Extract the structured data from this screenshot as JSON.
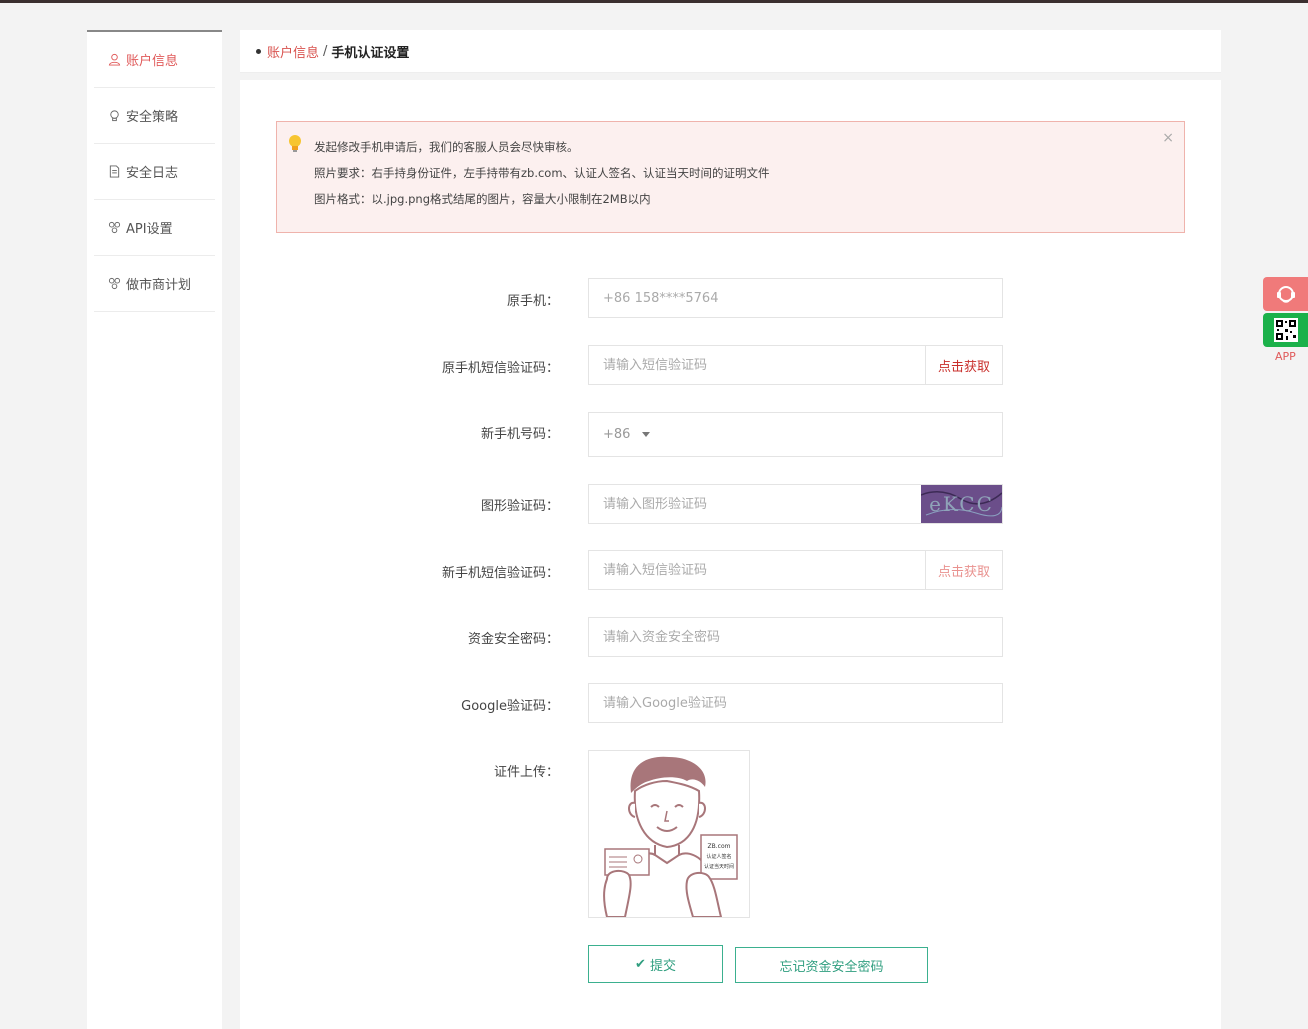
{
  "sidebar": {
    "items": [
      {
        "label": "账户信息",
        "icon": "user-icon",
        "active": true
      },
      {
        "label": "安全策略",
        "icon": "bulb-icon",
        "active": false
      },
      {
        "label": "安全日志",
        "icon": "document-icon",
        "active": false
      },
      {
        "label": "API设置",
        "icon": "api-icon",
        "active": false
      },
      {
        "label": "做市商计划",
        "icon": "api-icon",
        "active": false
      }
    ]
  },
  "breadcrumb": {
    "parent": "账户信息",
    "separator": "/",
    "current": "手机认证设置"
  },
  "alert": {
    "line1": "发起修改手机申请后，我们的客服人员会尽快审核。",
    "line2": "照片要求：右手持身份证件，左手持带有zb.com、认证人签名、认证当天时间的证明文件",
    "line3": "图片格式：以.jpg.png格式结尾的图片，容量大小限制在2MB以内",
    "close": "×"
  },
  "form": {
    "old_phone_label": "原手机：",
    "old_phone_value": "+86 158****5764",
    "old_sms_label": "原手机短信验证码：",
    "old_sms_placeholder": "请输入短信验证码",
    "old_sms_btn": "点击获取",
    "new_phone_label": "新手机号码：",
    "country_code": "+86",
    "captcha_label": "图形验证码：",
    "captcha_placeholder": "请输入图形验证码",
    "captcha_text": "eKCC",
    "new_sms_label": "新手机短信验证码：",
    "new_sms_placeholder": "请输入短信验证码",
    "new_sms_btn": "点击获取",
    "fund_pwd_label": "资金安全密码：",
    "fund_pwd_placeholder": "请输入资金安全密码",
    "google_label": "Google验证码：",
    "google_placeholder": "请输入Google验证码",
    "upload_label": "证件上传：",
    "card_text1": "ZB.com",
    "card_text2": "认证人签名",
    "card_text3": "认证当天时间",
    "submit": "提交",
    "forgot": "忘记资金安全密码"
  },
  "float": {
    "app_label": "APP"
  },
  "colors": {
    "accent_red": "#d9534f",
    "accent_green": "#3bb08f",
    "alert_bg": "#fcf0ef"
  }
}
